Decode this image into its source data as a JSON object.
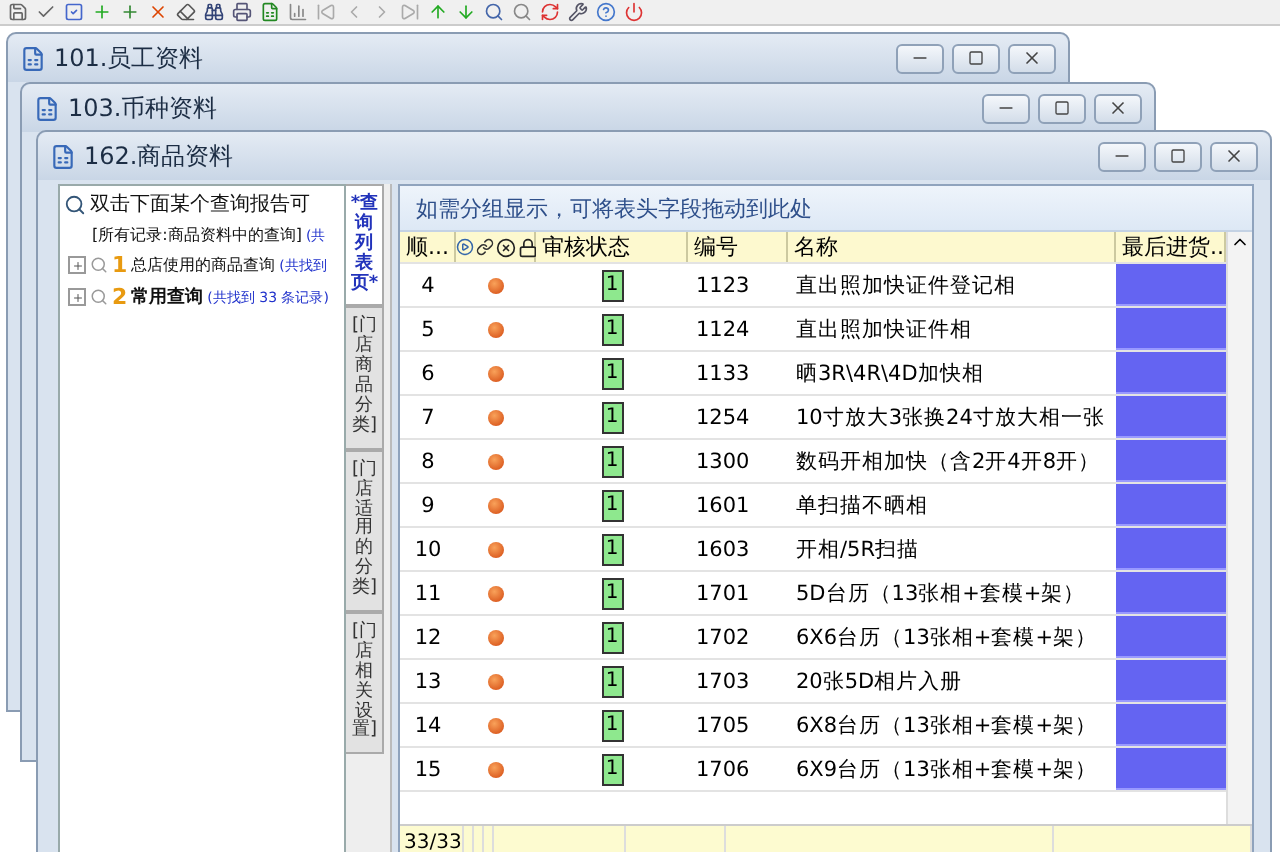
{
  "windows": [
    {
      "title": "101.员工资料"
    },
    {
      "title": "103.币种资料"
    },
    {
      "title": "162.商品资料"
    }
  ],
  "query_tree": {
    "label": "双击下面某个查询报告可",
    "children": [
      {
        "kind": "leaf",
        "label": "[所有记录:商品资料中的查询]",
        "count": "(共"
      },
      {
        "kind": "group",
        "index": "1",
        "label": "总店使用的商品查询",
        "count": "(共找到",
        "expanded": false,
        "bold": false
      },
      {
        "kind": "group",
        "index": "2",
        "label": "常用查询",
        "count": "(共找到 33 条记录)",
        "expanded": false,
        "bold": true
      }
    ]
  },
  "side_tabs": [
    {
      "label": "*查询列表页*",
      "selected": true
    },
    {
      "label": "[门店商品分类]",
      "selected": false
    },
    {
      "label": "[门店适用的分类]",
      "selected": false
    },
    {
      "label": "[门店相关设置]",
      "selected": false
    }
  ],
  "group_hint": "如需分组显示，可将表头字段拖动到此处",
  "table": {
    "columns": [
      "顺...",
      "审核状态",
      "编号",
      "名称",
      "最后进货..."
    ],
    "rows": [
      {
        "seq": "4",
        "audit": "1",
        "code": "1123",
        "name": "直出照加快证件登记相"
      },
      {
        "seq": "5",
        "audit": "1",
        "code": "1124",
        "name": "直出照加快证件相"
      },
      {
        "seq": "6",
        "audit": "1",
        "code": "1133",
        "name": "晒3R\\4R\\4D加快相"
      },
      {
        "seq": "7",
        "audit": "1",
        "code": "1254",
        "name": "10寸放大3张换24寸放大相一张"
      },
      {
        "seq": "8",
        "audit": "1",
        "code": "1300",
        "name": "数码开相加快（含2开4开8开）"
      },
      {
        "seq": "9",
        "audit": "1",
        "code": "1601",
        "name": "单扫描不晒相"
      },
      {
        "seq": "10",
        "audit": "1",
        "code": "1603",
        "name": "开相/5R扫描"
      },
      {
        "seq": "11",
        "audit": "1",
        "code": "1701",
        "name": "5D台历（13张相+套模+架）"
      },
      {
        "seq": "12",
        "audit": "1",
        "code": "1702",
        "name": "6X6台历（13张相+套模+架）"
      },
      {
        "seq": "13",
        "audit": "1",
        "code": "1703",
        "name": "20张5D相片入册"
      },
      {
        "seq": "14",
        "audit": "1",
        "code": "1705",
        "name": "6X8台历（13张相+套模+架）"
      },
      {
        "seq": "15",
        "audit": "1",
        "code": "1706",
        "name": "6X9台历（13张相+套模+架）"
      }
    ],
    "footer": "33/33"
  }
}
